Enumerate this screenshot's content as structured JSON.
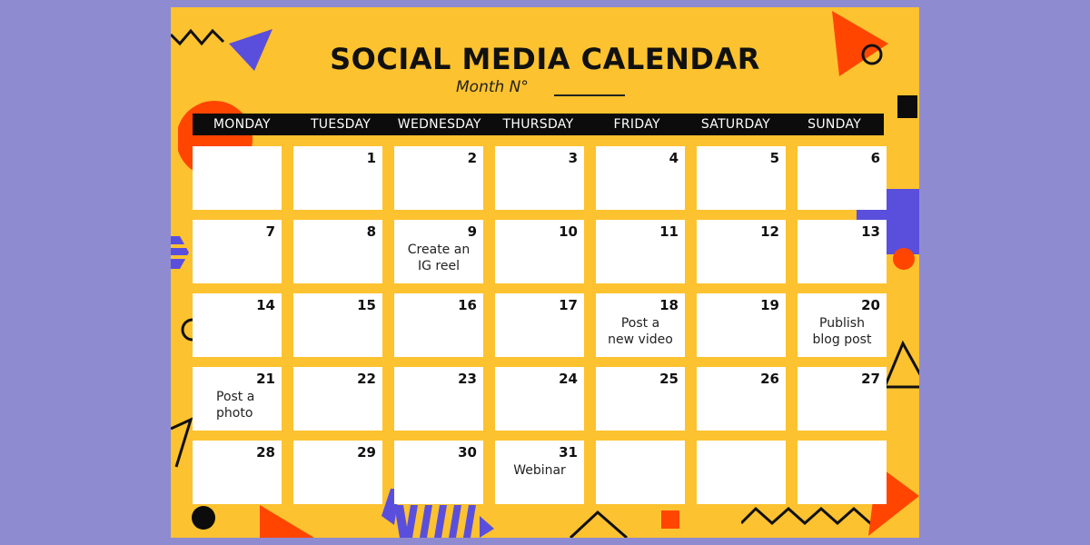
{
  "page": {
    "title": "SOCIAL MEDIA CALENDAR",
    "subtitle": "Month N°",
    "colors": {
      "background": "#8f8bd0",
      "sheet": "#fdc22f",
      "accent_red": "#ff4500",
      "accent_purple": "#5a4fdc",
      "header_bar": "#0c0c0c"
    }
  },
  "weekdays": [
    "MONDAY",
    "TUESDAY",
    "WEDNESDAY",
    "THURSDAY",
    "FRIDAY",
    "SATURDAY",
    "SUNDAY"
  ],
  "cells": [
    {
      "day": "",
      "note": ""
    },
    {
      "day": "1",
      "note": ""
    },
    {
      "day": "2",
      "note": ""
    },
    {
      "day": "3",
      "note": ""
    },
    {
      "day": "4",
      "note": ""
    },
    {
      "day": "5",
      "note": ""
    },
    {
      "day": "6",
      "note": ""
    },
    {
      "day": "7",
      "note": ""
    },
    {
      "day": "8",
      "note": ""
    },
    {
      "day": "9",
      "note": "Create an\nIG reel"
    },
    {
      "day": "10",
      "note": ""
    },
    {
      "day": "11",
      "note": ""
    },
    {
      "day": "12",
      "note": ""
    },
    {
      "day": "13",
      "note": ""
    },
    {
      "day": "14",
      "note": ""
    },
    {
      "day": "15",
      "note": ""
    },
    {
      "day": "16",
      "note": ""
    },
    {
      "day": "17",
      "note": ""
    },
    {
      "day": "18",
      "note": "Post a\nnew video"
    },
    {
      "day": "19",
      "note": ""
    },
    {
      "day": "20",
      "note": "Publish\nblog post"
    },
    {
      "day": "21",
      "note": "Post a\nphoto"
    },
    {
      "day": "22",
      "note": ""
    },
    {
      "day": "23",
      "note": ""
    },
    {
      "day": "24",
      "note": ""
    },
    {
      "day": "25",
      "note": ""
    },
    {
      "day": "26",
      "note": ""
    },
    {
      "day": "27",
      "note": ""
    },
    {
      "day": "28",
      "note": ""
    },
    {
      "day": "29",
      "note": ""
    },
    {
      "day": "30",
      "note": ""
    },
    {
      "day": "31",
      "note": "Webinar"
    },
    {
      "day": "",
      "note": ""
    },
    {
      "day": "",
      "note": ""
    },
    {
      "day": "",
      "note": ""
    }
  ]
}
